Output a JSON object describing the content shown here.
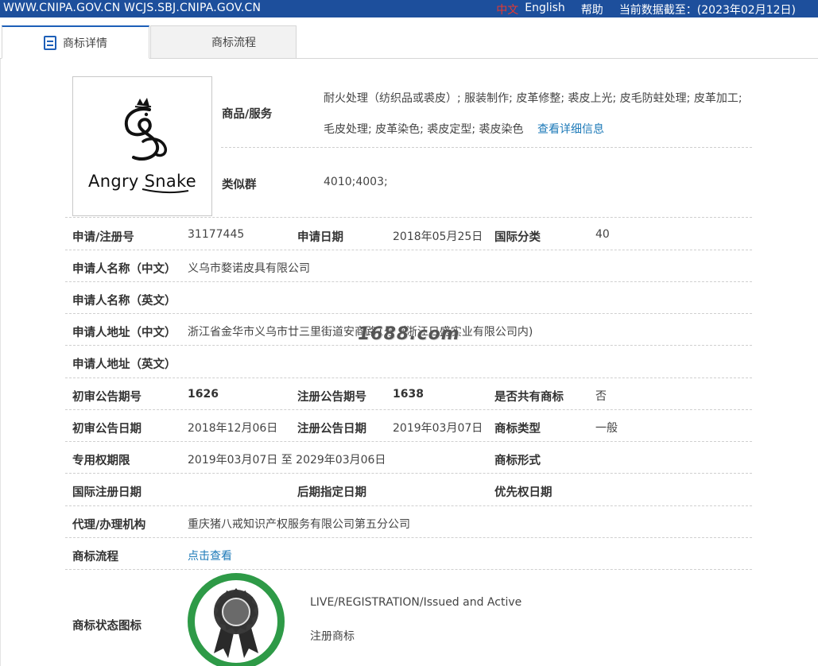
{
  "topbar": {
    "site": "WWW.CNIPA.GOV.CN WCJS.SBJ.CNIPA.GOV.CN",
    "lang_cn": "中文",
    "lang_en": "English",
    "help": "帮助",
    "data_date": "当前数据截至：(2023年02月12日)"
  },
  "tabs": [
    {
      "label": "商标详情",
      "icon": "document-icon",
      "active": true
    },
    {
      "label": "商标流程",
      "icon": "list-icon",
      "active": false
    }
  ],
  "trademark": {
    "logo_text": "Angry Snake",
    "goods_label": "商品/服务",
    "goods_line1": "耐火处理（纺织品或裘皮）; 服装制作; 皮革修整; 裘皮上光; 皮毛防蛀处理; 皮革加工;",
    "goods_line2": "毛皮处理; 皮革染色; 裘皮定型; 裘皮染色",
    "goods_more": "查看详细信息",
    "similar_label": "类似群",
    "similar_value": "4010;4003;"
  },
  "fields": {
    "reg_no_label": "申请/注册号",
    "reg_no": "31177445",
    "app_date_label": "申请日期",
    "app_date": "2018年05月25日",
    "intl_class_label": "国际分类",
    "intl_class": "40",
    "applicant_cn_label": "申请人名称（中文）",
    "applicant_cn": "义乌市婺诺皮具有限公司",
    "applicant_en_label": "申请人名称（英文）",
    "address_cn_label": "申请人地址（中文）",
    "address_cn": "浙江省金华市义乌市廿三里街道安商路1号（浙江日盛实业有限公司内)",
    "address_en_label": "申请人地址（英文）",
    "prelim_no_label": "初审公告期号",
    "prelim_no": "1626",
    "reg_pub_no_label": "注册公告期号",
    "reg_pub_no": "1638",
    "shared_label": "是否共有商标",
    "shared": "否",
    "prelim_date_label": "初审公告日期",
    "prelim_date": "2018年12月06日",
    "reg_pub_date_label": "注册公告日期",
    "reg_pub_date": "2019年03月07日",
    "tm_type_label": "商标类型",
    "tm_type": "一般",
    "exclusive_label": "专用权期限",
    "exclusive": "2019年03月07日 至 2029年03月06日",
    "tm_form_label": "商标形式",
    "intl_reg_date_label": "国际注册日期",
    "later_date_label": "后期指定日期",
    "priority_label": "优先权日期",
    "agent_label": "代理/办理机构",
    "agent": "重庆猪八戒知识产权服务有限公司第五分公司",
    "process_label": "商标流程",
    "process_link": "点击查看",
    "status_icon_label": "商标状态图标",
    "status_en": "LIVE/REGISTRATION/Issued and Active",
    "status_cn": "注册商标"
  },
  "watermark": "1688.com",
  "colors": {
    "topbar": "#1d4f9c",
    "link": "#1d7ab8",
    "badge_ring": "#2e9a47",
    "lang_active": "#e8392f"
  }
}
